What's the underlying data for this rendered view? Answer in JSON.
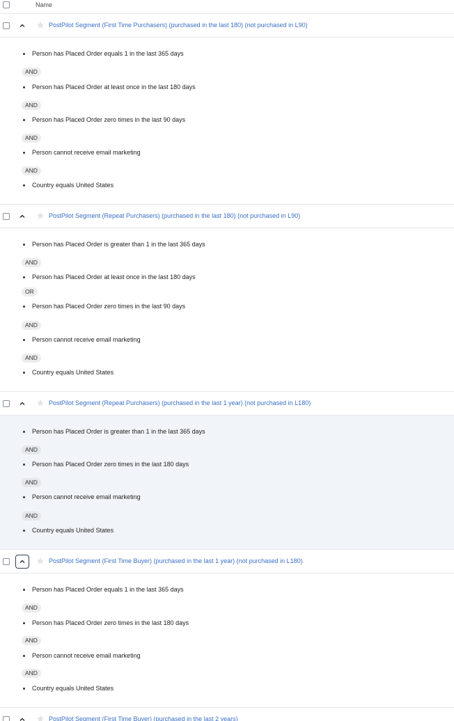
{
  "table": {
    "name_column": "Name"
  },
  "segments": [
    {
      "name": "PostPilot Segment (First Time Purchasers) (purchased in the last 180) (not purchased in L90)",
      "conditions": [
        "Person has Placed Order equals 1 in the last 365 days",
        "Person has Placed Order at least once in the last 180 days",
        "Person has Placed Order zero times in the last 90 days",
        "Person cannot receive email marketing",
        "Country equals United States"
      ],
      "operators": [
        "AND",
        "AND",
        "AND",
        "AND"
      ]
    },
    {
      "name": "PostPilot Segment (Repeat Purchasers) (purchased in the last 180) (not purchased in L90)",
      "conditions": [
        "Person has Placed Order is greater than 1 in the last 365 days",
        "Person has Placed Order at least once in the last 180 days",
        "Person has Placed Order zero times in the last 90 days",
        "Person cannot receive email marketing",
        "Country equals United States"
      ],
      "operators": [
        "AND",
        "OR",
        "AND",
        "AND"
      ]
    },
    {
      "name": "PostPilot Segment (Repeat Purchasers) (purchased in the last 1 year) (not purchased in L180)",
      "conditions": [
        "Person has Placed Order is greater than 1 in the last 365 days",
        "Person has Placed Order zero times in the last 180 days",
        "Person cannot receive email marketing",
        "Country equals United States"
      ],
      "operators": [
        "AND",
        "AND",
        "AND"
      ]
    },
    {
      "name": "PostPilot Segment (First Time Buyer) (purchased in the last 1 year) (not purchased in L180)",
      "conditions": [
        "Person has Placed Order equals 1 in the last 365 days",
        "Person has Placed Order zero times in the last 180 days",
        "Person cannot receive email marketing",
        "Country equals United States"
      ],
      "operators": [
        "AND",
        "AND",
        "AND"
      ]
    },
    {
      "name": "PostPilot Segment (First Time Buyer) (purchased in the last 2 years)"
    }
  ],
  "colors": {
    "link": "#3a6fc4",
    "hover_bg": "#f1f4f8",
    "pill_bg": "#ececec"
  },
  "icons": {
    "expand": "chevron-up-icon",
    "favorite": "star-icon"
  }
}
